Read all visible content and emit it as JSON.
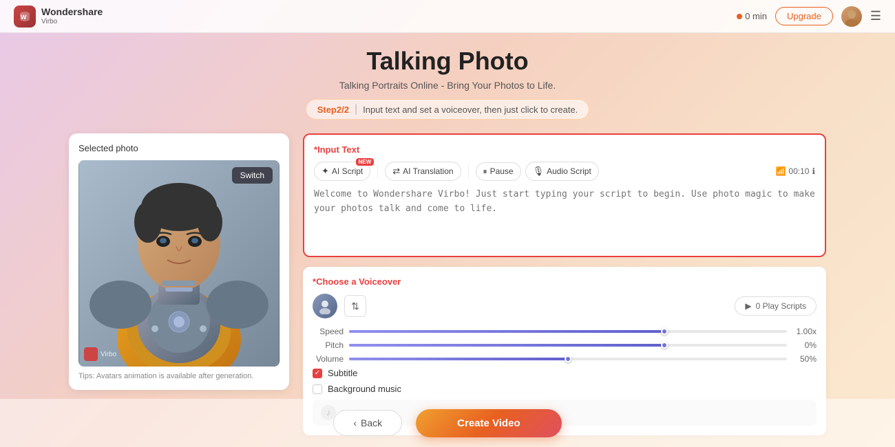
{
  "app": {
    "logo_name": "Wondershare",
    "logo_sub": "Virbo",
    "timer": "0 min",
    "upgrade_label": "Upgrade",
    "menu_icon": "☰"
  },
  "page": {
    "title": "Talking Photo",
    "subtitle": "Talking Portraits Online - Bring Your Photos to Life.",
    "step_label": "Step2/2",
    "step_divider": "|",
    "step_desc": "Input text and set a voiceover, then just click to create."
  },
  "left_panel": {
    "selected_photo_label": "Selected photo",
    "switch_label": "Switch",
    "watermark": "Virbo",
    "tips": "Tips: Avatars animation is available after generation."
  },
  "input_text": {
    "section_title_prefix": "*",
    "section_title": "Input Text",
    "ai_script_label": "AI Script",
    "ai_script_badge": "NEW",
    "ai_translation_label": "AI Translation",
    "pause_label": "Pause",
    "audio_script_label": "Audio Script",
    "timer": "00:10",
    "placeholder_text": "Welcome to Wondershare Virbo! Just start typing your script to begin. Use photo magic to make your photos talk and come to life."
  },
  "voiceover": {
    "section_title_prefix": "*",
    "section_title": "Choose a Voiceover",
    "play_scripts_label": "0 Play Scripts",
    "speed_label": "Speed",
    "speed_value": "1.00x",
    "speed_pct": 72,
    "pitch_label": "Pitch",
    "pitch_value": "0%",
    "pitch_pct": 72,
    "volume_label": "Volume",
    "volume_value": "50%",
    "volume_pct": 50
  },
  "subtitle": {
    "label": "Subtitle",
    "checked": true
  },
  "background_music": {
    "label": "Background music",
    "checked": false,
    "music_placeholder": "Music"
  },
  "buttons": {
    "back_label": "Back",
    "create_label": "Create Video"
  }
}
